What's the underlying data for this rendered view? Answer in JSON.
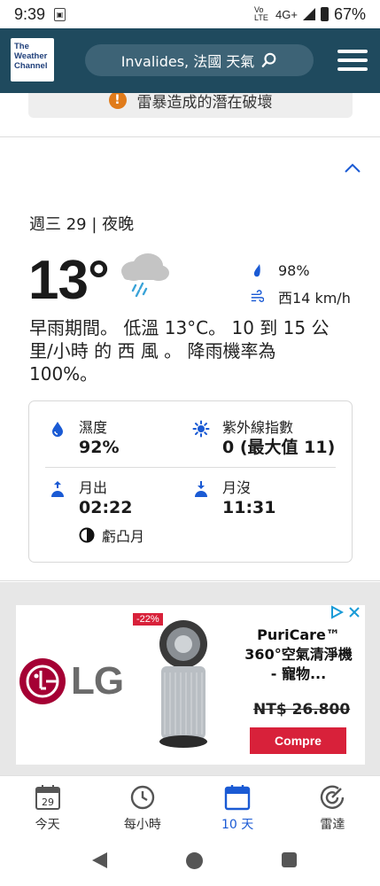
{
  "status_bar": {
    "time": "9:39",
    "network": "4G+",
    "volte": "Vo LTE",
    "battery": "67%"
  },
  "header": {
    "logo_lines": [
      "The",
      "Weather",
      "Channel"
    ],
    "location": "Invalides, 法國 天氣"
  },
  "alert": {
    "text": "雷暴造成的潛在破壞"
  },
  "forecast": {
    "day_label": "週三 29 | 夜晚",
    "temperature": "13°",
    "precip_chance": "98%",
    "wind": "西14 km/h",
    "narrative": "早雨期間。 低溫 13°C。 10 到 15 公里/小時 的 西 風 。 降雨機率為 100%。"
  },
  "details": {
    "humidity_label": "濕度",
    "humidity_value": "92%",
    "uv_label": "紫外線指數",
    "uv_value": "0 (最大值 11)",
    "moonrise_label": "月出",
    "moonrise_value": "02:22",
    "moonset_label": "月沒",
    "moonset_value": "11:31",
    "moon_phase": "虧凸月"
  },
  "ad": {
    "discount": "-22%",
    "brand": "LG",
    "title": "PuriCare™ 360°空氣清淨機 - 寵物...",
    "price": "NT$ 26.800",
    "cta": "Compre"
  },
  "bottom_nav": {
    "today_date": "29",
    "items": [
      {
        "label": "今天"
      },
      {
        "label": "每小時"
      },
      {
        "label": "10 天"
      },
      {
        "label": "雷達"
      }
    ]
  },
  "colors": {
    "header_bg": "#1f4a5e",
    "accent_blue": "#1a5ad4",
    "alert_orange": "#e07b1a",
    "ad_red": "#d8213a"
  }
}
